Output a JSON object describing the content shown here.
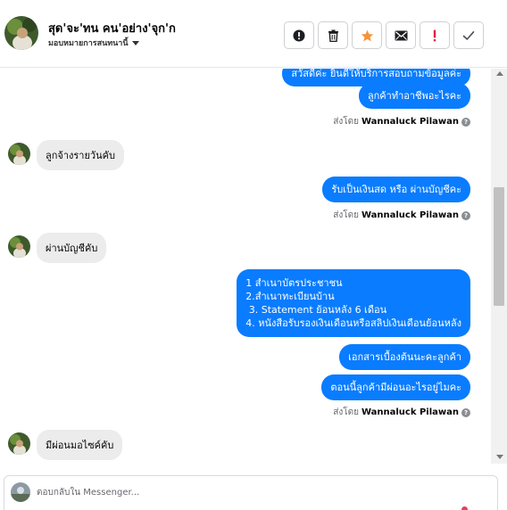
{
  "header": {
    "title": "สุด'จะ'ทน คน'อย่าง'จุก'ก",
    "assign_label": "มอบหมายการสนทนานี้",
    "actions": [
      "alert-icon",
      "trash-icon",
      "star-icon",
      "mail-icon",
      "exclamation-icon",
      "check-icon"
    ],
    "star_color": "#f7923a",
    "exclaim_color": "#e41e3f"
  },
  "messages": [
    {
      "dir": "out",
      "text": "สวัสดีค่ะ  ยินดีให้บริการสอบถามข้อมูลค่ะ"
    },
    {
      "dir": "out",
      "text": "ลูกค้าทำอาชีพอะไรคะ"
    },
    {
      "dir": "meta",
      "prefix": "ส่งโดย",
      "name": "Wannaluck Pilawan"
    },
    {
      "dir": "in",
      "text": "ลูกจ้างรายวันคับ"
    },
    {
      "dir": "out",
      "text": "รับเป็นเงินสด หรือ ผ่านบัญชีคะ"
    },
    {
      "dir": "meta",
      "prefix": "ส่งโดย",
      "name": "Wannaluck Pilawan"
    },
    {
      "dir": "in",
      "text": "ผ่านบัญชีคับ"
    },
    {
      "dir": "out",
      "lines": [
        "1 สำเนาบัตรประชาชน",
        "2.สำเนาทะเบียนบ้าน",
        " 3. Statement ย้อนหลัง 6 เดือน",
        "4. หนังสือรับรองเงินเดือนหรือสลิปเงินเดือนย้อนหลัง"
      ]
    },
    {
      "dir": "out",
      "text": "เอกสารเบื้องต้นนะคะลูกค้า"
    },
    {
      "dir": "out",
      "text": "ตอนนี้ลูกค้ามีผ่อนอะไรอยู่ไมคะ"
    },
    {
      "dir": "meta",
      "prefix": "ส่งโดย",
      "name": "Wannaluck Pilawan"
    },
    {
      "dir": "in",
      "text": "มีผ่อนมอไซค์คับ"
    }
  ],
  "composer": {
    "placeholder": "ตอบกลับใน Messenger..."
  },
  "colors": {
    "outgoing_bubble": "#0a7cff",
    "incoming_bubble": "#ececec"
  }
}
